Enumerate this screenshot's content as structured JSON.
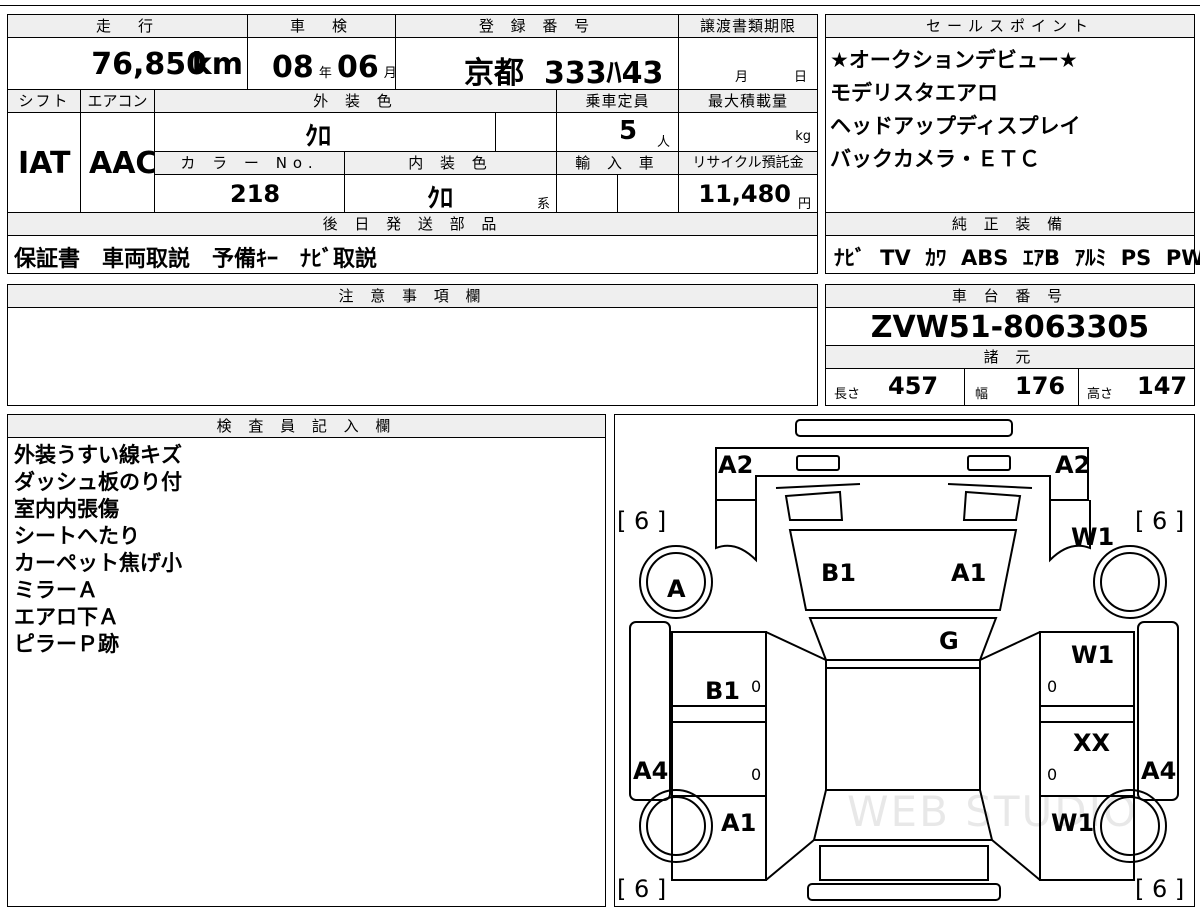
{
  "headers": {
    "mileage": "走　行",
    "inspection": "車　検",
    "registration": "登 録 番 号",
    "transfer_deadline": "譲渡書類期限",
    "sales_points": "セールスポイント",
    "shift": "シフト",
    "aircon": "エアコン",
    "exterior_color": "外 装 色",
    "capacity": "乗車定員",
    "max_load": "最大積載量",
    "color_no": "カ ラ ー No.",
    "interior_color": "内 装 色",
    "import": "輸 入 車",
    "recycle": "リサイクル預託金",
    "later_parts": "後 日 発 送 部 品",
    "factory_equipment": "純 正 装 備",
    "notes": "注 意 事 項 欄",
    "chassis_no": "車 台 番 号",
    "specs": "諸 元",
    "inspector_notes": "検 査 員 記 入 欄"
  },
  "vehicle": {
    "mileage_value": "76,850",
    "mileage_unit": "km",
    "inspection_year": "08",
    "year_unit": "年",
    "inspection_month": "06",
    "month_unit": "月",
    "plate_area": "京都",
    "plate_number": "333ﾊ43",
    "transfer_month_unit": "月",
    "transfer_day_unit": "日",
    "shift": "IAT",
    "aircon": "AAC",
    "exterior_color": "ｸﾛ",
    "capacity": "5",
    "capacity_unit": "人",
    "max_load_unit": "kg",
    "color_no": "218",
    "interior_color": "ｸﾛ",
    "interior_suffix": "系",
    "recycle_fee": "11,480",
    "recycle_unit": "円",
    "later_parts": "保証書　車両取説　予備ｷｰ　ﾅﾋﾞ取説",
    "chassis_no": "ZVW51-8063305",
    "length_label": "長さ",
    "length": "457",
    "width_label": "幅",
    "width": "176",
    "height_label": "高さ",
    "height": "147"
  },
  "sales_points": [
    "★オークションデビュー★",
    "モデリスタエアロ",
    "ヘッドアップディスプレイ",
    "バックカメラ・ＥＴＣ"
  ],
  "equipment": [
    "ﾅﾋﾞ",
    "TV",
    "ｶﾜ",
    "ABS",
    "ｴｱB",
    "ｱﾙﾐ",
    "PS",
    "PW"
  ],
  "inspector_notes": [
    "外装うすい線キズ",
    "ダッシュ板のり付",
    "室内内張傷",
    "シートへたり",
    "カーペット焦げ小",
    "ミラーＡ",
    "エアロ下Ａ",
    "ピラーＰ跡"
  ],
  "diagram": {
    "front_left_corner": "A2",
    "front_right_corner": "A2",
    "left_front_tire": "[ 6 ]",
    "right_front_tire": "[ 6 ]",
    "left_rear_tire": "[ 6 ]",
    "right_rear_tire": "[ 6 ]",
    "right_front_wheel": "W1",
    "left_front_wheel_mark": "A",
    "hood_left": "B1",
    "hood_right": "A1",
    "windshield": "G",
    "right_front_door": "W1",
    "left_front_door": "B1",
    "left_front_door_small": "0",
    "right_front_door_small": "0",
    "right_rear_door": "XX",
    "left_rear_door_small": "0",
    "right_rear_door_small": "0",
    "left_side": "A4",
    "right_side": "A4",
    "left_rear_wheel": "A1",
    "right_rear_wheel": "W1",
    "watermark": "WEB STUDIO"
  }
}
